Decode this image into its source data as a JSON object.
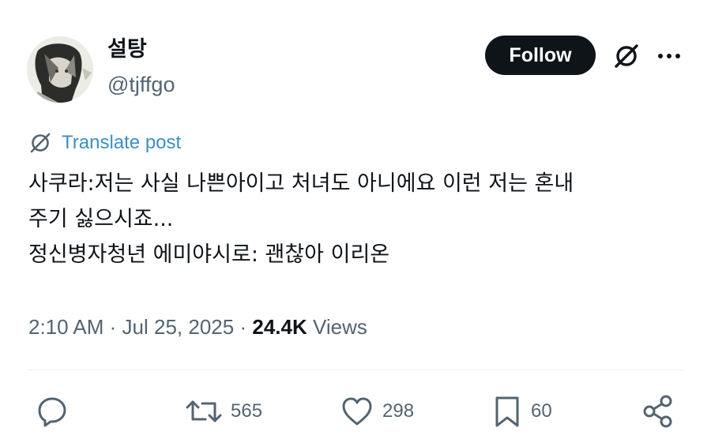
{
  "header": {
    "display_name": "설탕",
    "handle": "@tjffgo",
    "follow_label": "Follow",
    "grok_icon": "grok-icon",
    "more_icon": "more-icon"
  },
  "translate": {
    "label": "Translate post"
  },
  "post": {
    "lines": [
      "사쿠라:저는 사실 나쁜아이고 처녀도 아니에요 이런 저는 혼내",
      "주기 싫으시죠...",
      "정신병자청년 에미야시로: 괜찮아 이리온"
    ]
  },
  "meta": {
    "time": "2:10 AM",
    "separator": "·",
    "date": "Jul 25, 2025",
    "views_count": "24.4K",
    "views_label": "Views"
  },
  "actions": {
    "reply": {
      "icon": "reply-icon",
      "count": ""
    },
    "repost": {
      "icon": "repost-icon",
      "count": "565"
    },
    "like": {
      "icon": "heart-icon",
      "count": "298"
    },
    "bookmark": {
      "icon": "bookmark-icon",
      "count": "60"
    },
    "share": {
      "icon": "share-icon",
      "count": ""
    }
  },
  "colors": {
    "text": "#0f1419",
    "secondary": "#536471",
    "link": "#3b8fc4",
    "button_bg": "#0f1419"
  }
}
